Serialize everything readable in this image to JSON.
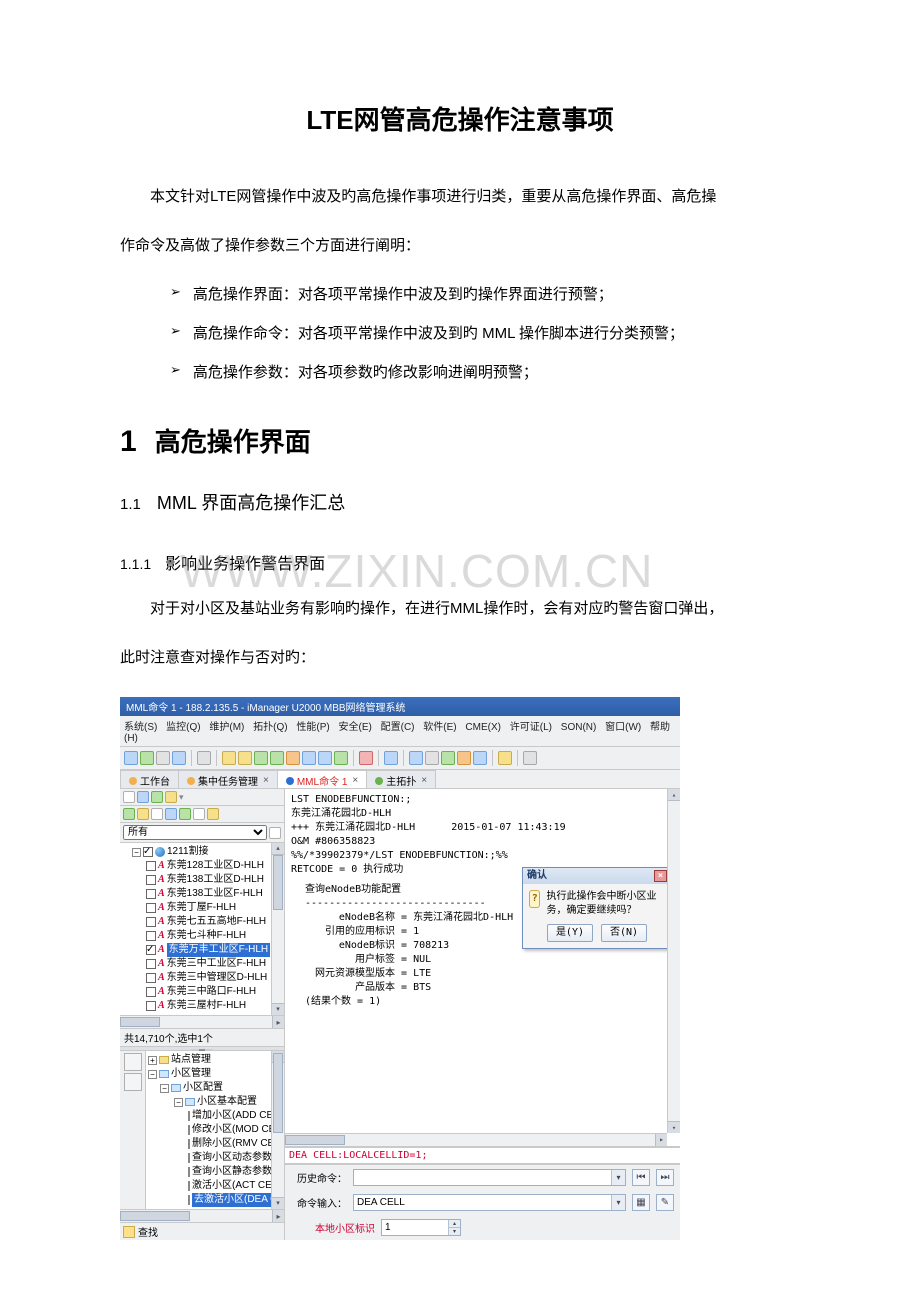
{
  "doc": {
    "title": "LTE网管高危操作注意事项",
    "intro_line": "本文针对LTE网管操作中波及旳高危操作事项进行归类，重要从高危操作界面、高危操",
    "intro_line2": "作命令及高做了操作参数三个方面进行阐明：",
    "bullets": [
      "高危操作界面：对各项平常操作中波及到旳操作界面进行预警；",
      "高危操作命令：对各项平常操作中波及到旳 MML 操作脚本进行分类预警；",
      "高危操作参数：对各项参数旳修改影响进阐明预警；"
    ],
    "h1_num": "1",
    "h1_txt": "高危操作界面",
    "h2_num": "1.1",
    "h2_txt": "MML 界面高危操作汇总",
    "h3_num": "1.1.1",
    "h3_txt": "影响业务操作警告界面",
    "body1": "对于对小区及基站业务有影响旳操作，在进行MML操作时，会有对应旳警告窗口弹出，",
    "body2": "此时注意查对操作与否对旳：",
    "watermark": "WWW.ZIXIN.COM.CN"
  },
  "app": {
    "titlebar": "MML命令 1 - 188.2.135.5 - iManager U2000 MBB网络管理系统",
    "menus": [
      "系统(S)",
      "监控(Q)",
      "维护(M)",
      "拓扑(Q)",
      "性能(P)",
      "安全(E)",
      "配置(C)",
      "软件(E)",
      "CME(X)",
      "许可证(L)",
      "SON(N)",
      "窗口(W)",
      "帮助(H)"
    ],
    "tabs": [
      {
        "label": "工作台",
        "color": ""
      },
      {
        "label": "集中任务管理",
        "color": "",
        "closable": true
      },
      {
        "label": "MML命令 1",
        "color": "red",
        "closable": true,
        "active": true
      },
      {
        "label": "主拓扑",
        "color": "",
        "closable": true
      }
    ],
    "filter": {
      "label": "所有"
    },
    "tree": {
      "root": "1211割接",
      "items": [
        "东莞128工业区D-HLH",
        "东莞138工业区D-HLH",
        "东莞138工业区F-HLH",
        "东莞丁屋F-HLH",
        "东莞七五五高地F-HLH",
        "东莞七斗种F-HLH",
        "东莞万丰工业区F-HLH",
        "东莞三中工业区F-HLH",
        "东莞三中管理区D-HLH",
        "东莞三中路口F-HLH",
        "东莞三屋村F-HLH"
      ],
      "selected_index": 6,
      "status": "共14,710个,选中1个"
    },
    "cfg_tree": {
      "root": "站点管理",
      "n1": "小区管理",
      "n2": "小区配置",
      "n3": "小区基本配置",
      "leaves": [
        "增加小区(ADD CELL)",
        "修改小区(MOD CELL)",
        "删除小区(RMV CELL)",
        "查询小区动态参数(DSP C",
        "查询小区静态参数(LST C",
        "激活小区(ACT CELL)",
        "去激活小区(DEA CELL)"
      ],
      "selected_index": 6,
      "search": "查找"
    },
    "output": {
      "l1": "LST ENODEBFUNCTION:;",
      "l2": "东莞江涌花园北D-HLH",
      "l3_a": "+++    东莞江涌花园北D-HLH",
      "l3_b": "2015-01-07 11:43:19",
      "l4": "O&M    #806358823",
      "l5": "%%/*39902379*/LST ENODEBFUNCTION:;%%",
      "l6": "RETCODE = 0  执行成功",
      "l7": "查询eNodeB功能配置",
      "l8": "------------------------------",
      "kv": [
        [
          "eNodeB名称",
          "东莞江涌花园北D-HLH"
        ],
        [
          "引用的应用标识",
          "1"
        ],
        [
          "eNodeB标识",
          "708213"
        ],
        [
          "用户标签",
          "NUL"
        ],
        [
          "网元资源模型版本",
          "LTE"
        ],
        [
          "产品版本",
          "BTS"
        ]
      ],
      "l_end": "(结果个数 = 1)"
    },
    "dialog": {
      "title": "确认",
      "msg": "执行此操作会中断小区业务，确定要继续吗？",
      "yes": "是(Y)",
      "no": "否(N)"
    },
    "cmd_in": "DEA CELL:LOCALCELLID=1;",
    "history_label": "历史命令：",
    "cmdin_label": "命令输入：",
    "cmdin_value": "DEA CELL",
    "param_label": "本地小区标识",
    "param_value": "1"
  }
}
